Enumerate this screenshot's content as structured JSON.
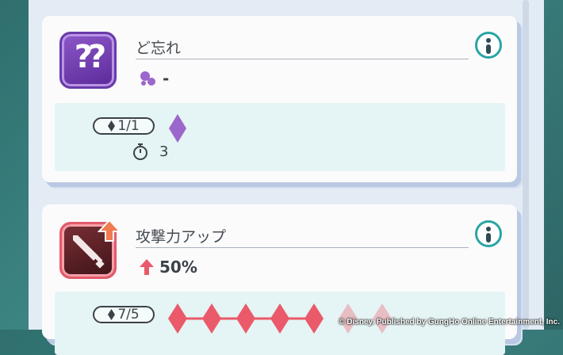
{
  "skills": [
    {
      "name": "ど忘れ",
      "icon": "mystery-question-icon",
      "icon_text": "??",
      "effect_icon": "purple-drop-icon",
      "effect_value": "-",
      "level_label": "1/1",
      "level_current": 1,
      "level_max": 1,
      "cooldown": "3",
      "accent_color": "#9b67cc"
    },
    {
      "name": "攻撃力アップ",
      "icon": "sword-icon",
      "effect_icon": "red-up-arrow-icon",
      "effect_value": "50%",
      "level_label": "7/5",
      "level_filled": 5,
      "level_total": 7,
      "accent_color": "#ea5a6a"
    }
  ],
  "copyright": "© Disney.   Published by GungHo Online Entertainment, Inc."
}
